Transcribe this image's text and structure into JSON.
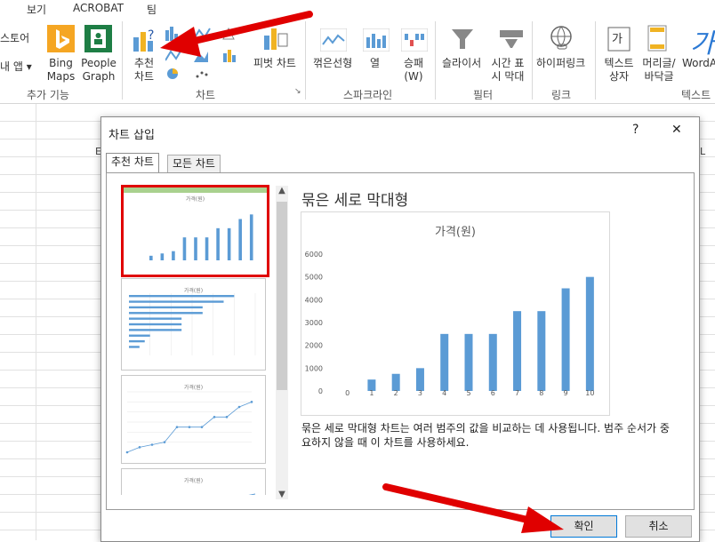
{
  "menu": {
    "items": [
      "보기",
      "ACROBAT",
      "팀"
    ]
  },
  "ribbon": {
    "store_label": "스토어",
    "my_apps_label": "내 앱",
    "bing_label": "Bing Maps",
    "people_label": "People Graph",
    "addins_group": "추가 기능",
    "recommended_charts_label": "추천 차트",
    "pivot_chart_label": "피벗 차트",
    "charts_group": "차트",
    "sparkline_line_label": "꺾은선형",
    "sparkline_column_label": "열",
    "sparkline_winloss_label": "승패 (W)",
    "sparklines_group": "스파크라인",
    "slicer_label": "슬라이서",
    "timeline_label": "시간 표시 막대",
    "filters_group": "필터",
    "hyperlink_label": "하이퍼링크",
    "links_group": "링크",
    "textbox_label": "텍스트 상자",
    "header_footer_label": "머리글/ 바닥글",
    "wordart_label": "WordArt",
    "text_group": "텍스트"
  },
  "sheet": {
    "col_e": "E",
    "col_l": "L"
  },
  "dialog": {
    "title": "차트 삽입",
    "help": "?",
    "close": "✕",
    "tabs": [
      "추천 차트",
      "모든 차트"
    ],
    "preview_title": "묶은 세로 막대형",
    "description": "묶은 세로 막대형 차트는 여러 범주의 값을 비교하는 데 사용됩니다. 범주 순서가 중요하지 않을 때 이 차트를 사용하세요.",
    "ok": "확인",
    "cancel": "취소",
    "thumb_title": "가격(원)"
  },
  "colors": {
    "bar": "#5b9bd5",
    "highlight": "#e00000",
    "accent_bar": "#a9d18e"
  },
  "chart_data": {
    "type": "bar",
    "title": "가격(원)",
    "categories": [
      "0",
      "1",
      "2",
      "3",
      "4",
      "5",
      "6",
      "7",
      "8",
      "9",
      "10"
    ],
    "values": [
      0,
      500,
      750,
      1000,
      2500,
      2500,
      2500,
      3500,
      3500,
      4500,
      5000
    ],
    "ylim": [
      0,
      6000
    ],
    "yticks": [
      "0",
      "1000",
      "2000",
      "3000",
      "4000",
      "5000",
      "6000"
    ],
    "xlabel": "",
    "ylabel": "",
    "grid": false
  }
}
